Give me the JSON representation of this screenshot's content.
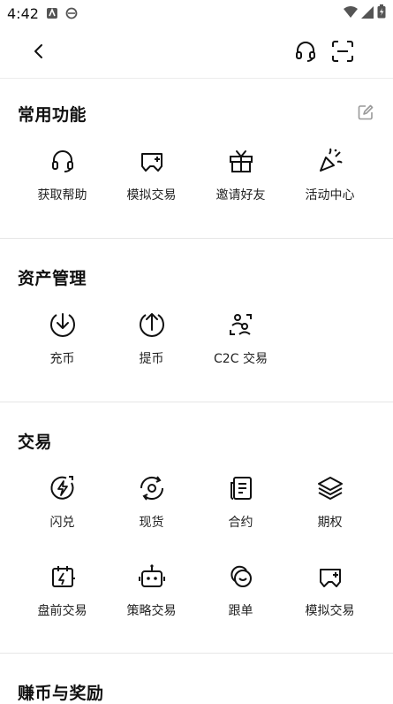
{
  "status_bar": {
    "time": "4:42"
  },
  "sections": {
    "common": {
      "title": "常用功能",
      "items": [
        {
          "label": "获取帮助",
          "icon": "headset-icon"
        },
        {
          "label": "模拟交易",
          "icon": "gamepad-icon"
        },
        {
          "label": "邀请好友",
          "icon": "gift-icon"
        },
        {
          "label": "活动中心",
          "icon": "party-popper-icon"
        }
      ]
    },
    "assets": {
      "title": "资产管理",
      "items": [
        {
          "label": "充币",
          "icon": "deposit-icon"
        },
        {
          "label": "提币",
          "icon": "withdraw-icon"
        },
        {
          "label": "C2C 交易",
          "icon": "c2c-icon"
        }
      ]
    },
    "trade": {
      "title": "交易",
      "items": [
        {
          "label": "闪兑",
          "icon": "flash-convert-icon"
        },
        {
          "label": "现货",
          "icon": "spot-icon"
        },
        {
          "label": "合约",
          "icon": "contract-icon"
        },
        {
          "label": "期权",
          "icon": "options-layers-icon"
        },
        {
          "label": "盘前交易",
          "icon": "premarket-calendar-icon"
        },
        {
          "label": "策略交易",
          "icon": "bot-icon"
        },
        {
          "label": "跟单",
          "icon": "copy-trade-icon"
        },
        {
          "label": "模拟交易",
          "icon": "gamepad-icon"
        }
      ]
    },
    "earn": {
      "title": "赚币与奖励"
    }
  }
}
